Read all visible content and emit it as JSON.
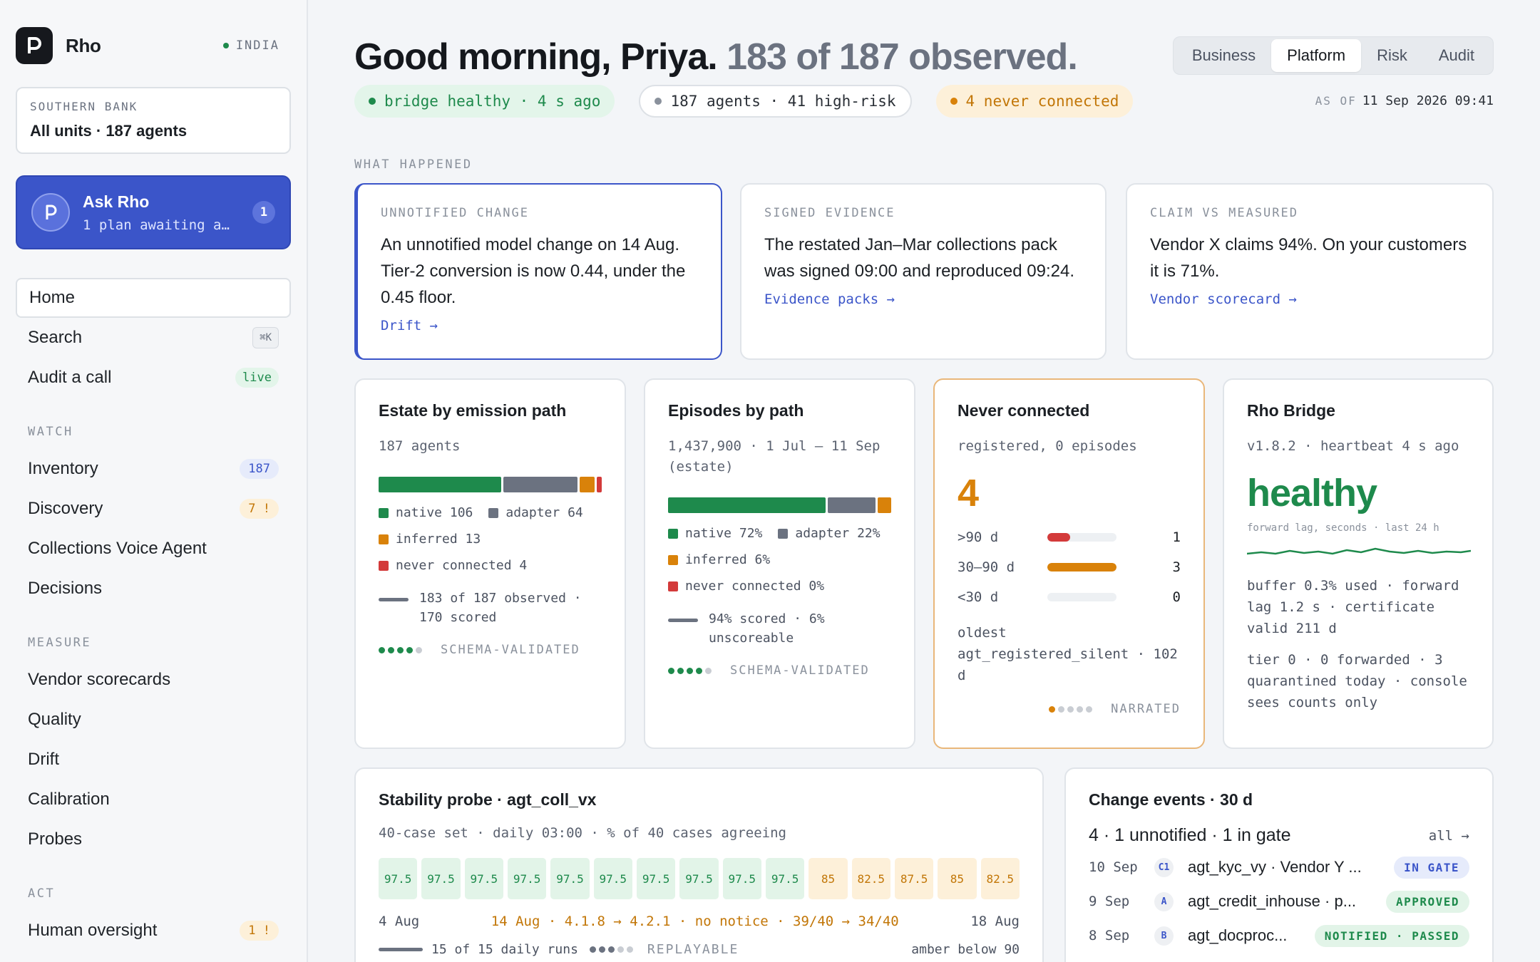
{
  "brand": {
    "name": "Rho",
    "region": "INDIA"
  },
  "unit": {
    "org": "SOUTHERN BANK",
    "scope": "All units · 187 agents"
  },
  "ask": {
    "title": "Ask Rho",
    "subtitle": "1 plan awaiting a…",
    "badge": "1"
  },
  "nav": {
    "home": "Home",
    "search": "Search",
    "search_kbd": "⌘K",
    "audit": "Audit a call",
    "audit_badge": "live",
    "watch_label": "WATCH",
    "inventory": "Inventory",
    "inventory_count": "187",
    "discovery": "Discovery",
    "discovery_badge": "7 !",
    "voice_agent": "Collections Voice Agent",
    "decisions": "Decisions",
    "measure_label": "MEASURE",
    "vendor": "Vendor scorecards",
    "quality": "Quality",
    "drift": "Drift",
    "calibration": "Calibration",
    "probes": "Probes",
    "act_label": "ACT",
    "oversight": "Human oversight",
    "oversight_badge": "1 !"
  },
  "header": {
    "greeting": "Good morning, Priya.",
    "observed": "183 of 187 observed.",
    "tabs": [
      "Business",
      "Platform",
      "Risk",
      "Audit"
    ],
    "active_tab": "Platform",
    "chip_bridge": "bridge healthy · 4 s ago",
    "chip_agents": "187 agents · 41 high-risk",
    "chip_never": "4 never connected",
    "asof_label": "AS OF",
    "asof_value": "11 Sep 2026 09:41"
  },
  "what_happened": {
    "label": "WHAT HAPPENED",
    "stories": [
      {
        "kicker": "UNNOTIFIED CHANGE",
        "text": "An unnotified model change on 14 Aug. Tier-2 conversion is now 0.44, under the 0.45 floor.",
        "link": "Drift →"
      },
      {
        "kicker": "SIGNED EVIDENCE",
        "text": "The restated Jan–Mar collections pack was signed 09:00 and reproduced 09:24.",
        "link": "Evidence packs →"
      },
      {
        "kicker": "CLAIM VS MEASURED",
        "text": "Vendor X claims 94%. On your customers it is 71%.",
        "link": "Vendor scorecard →"
      }
    ]
  },
  "estate": {
    "title": "Estate by emission path",
    "sub": "187 agents",
    "legend_native": "native 106",
    "legend_adapter": "adapter 64",
    "legend_inferred": "inferred 13",
    "legend_never": "never connected 4",
    "observed": "183 of 187 observed · 170 scored",
    "confidence": "SCHEMA-VALIDATED",
    "shares": {
      "native": 106,
      "adapter": 64,
      "inferred": 13,
      "never": 4
    }
  },
  "episodes": {
    "title": "Episodes by path",
    "sub": "1,437,900 · 1 Jul – 11 Sep (estate)",
    "legend_native": "native 72%",
    "legend_adapter": "adapter 22%",
    "legend_inferred": "inferred 6%",
    "legend_never": "never connected 0%",
    "scored": "94% scored · 6% unscoreable",
    "confidence": "SCHEMA-VALIDATED",
    "shares": {
      "native": 72,
      "adapter": 22,
      "inferred": 6,
      "never": 0
    }
  },
  "never": {
    "title": "Never connected",
    "sub": "registered, 0 episodes",
    "count": "4",
    "rows": [
      {
        "label": ">90 d",
        "count": "1",
        "fill": 0.33
      },
      {
        "label": "30–90 d",
        "count": "3",
        "fill": 1.0
      },
      {
        "label": "<30 d",
        "count": "0",
        "fill": 0
      }
    ],
    "oldest": "oldest agt_registered_silent · 102 d",
    "confidence": "NARRATED"
  },
  "bridge": {
    "title": "Rho Bridge",
    "sub": "v1.8.2 · heartbeat 4 s ago",
    "status": "healthy",
    "caption": "forward lag, seconds · last 24 h",
    "detail": "buffer 0.3% used · forward lag 1.2 s · certificate valid 211 d",
    "tier": "tier 0 · 0 forwarded · 3 quarantined today · console sees counts only"
  },
  "probe": {
    "title": "Stability probe · agt_coll_vx",
    "sub": "40-case set · daily 03:00 · % of 40 cases agreeing",
    "cells": [
      97.5,
      97.5,
      97.5,
      97.5,
      97.5,
      97.5,
      97.5,
      97.5,
      97.5,
      97.5,
      85,
      82.5,
      87.5,
      85,
      82.5
    ],
    "cell_labels": [
      "97.5",
      "97.5",
      "97.5",
      "97.5",
      "97.5",
      "97.5",
      "97.5",
      "97.5",
      "97.5",
      "97.5",
      "85",
      "82.5",
      "87.5",
      "85",
      "82.5"
    ],
    "threshold": 90,
    "start": "4 Aug",
    "event": "14 Aug · 4.1.8 → 4.2.1 · no notice · 39/40 → 34/40",
    "end": "18 Aug",
    "foot": "15 of 15 daily runs",
    "foot_confidence": "REPLAYABLE",
    "foot_right": "amber below 90"
  },
  "changes": {
    "title": "Change events · 30 d",
    "summary": "4 · 1 unnotified · 1 in gate",
    "all": "all →",
    "events": [
      {
        "date": "10 Sep",
        "icon": "C1",
        "name": "agt_kyc_vy · Vendor Y ...",
        "status": "IN GATE"
      },
      {
        "date": "9 Sep",
        "icon": "A",
        "name": "agt_credit_inhouse · p...",
        "status": "APPROVED"
      },
      {
        "date": "8 Sep",
        "icon": "B",
        "name": "agt_docproc...",
        "status": "NOTIFIED · PASSED"
      }
    ]
  },
  "colors": {
    "native": "#1e8a4c",
    "adapter": "#6b7280",
    "inferred": "#d9820a",
    "never": "#d33a3a",
    "accent": "#3b55c9"
  }
}
